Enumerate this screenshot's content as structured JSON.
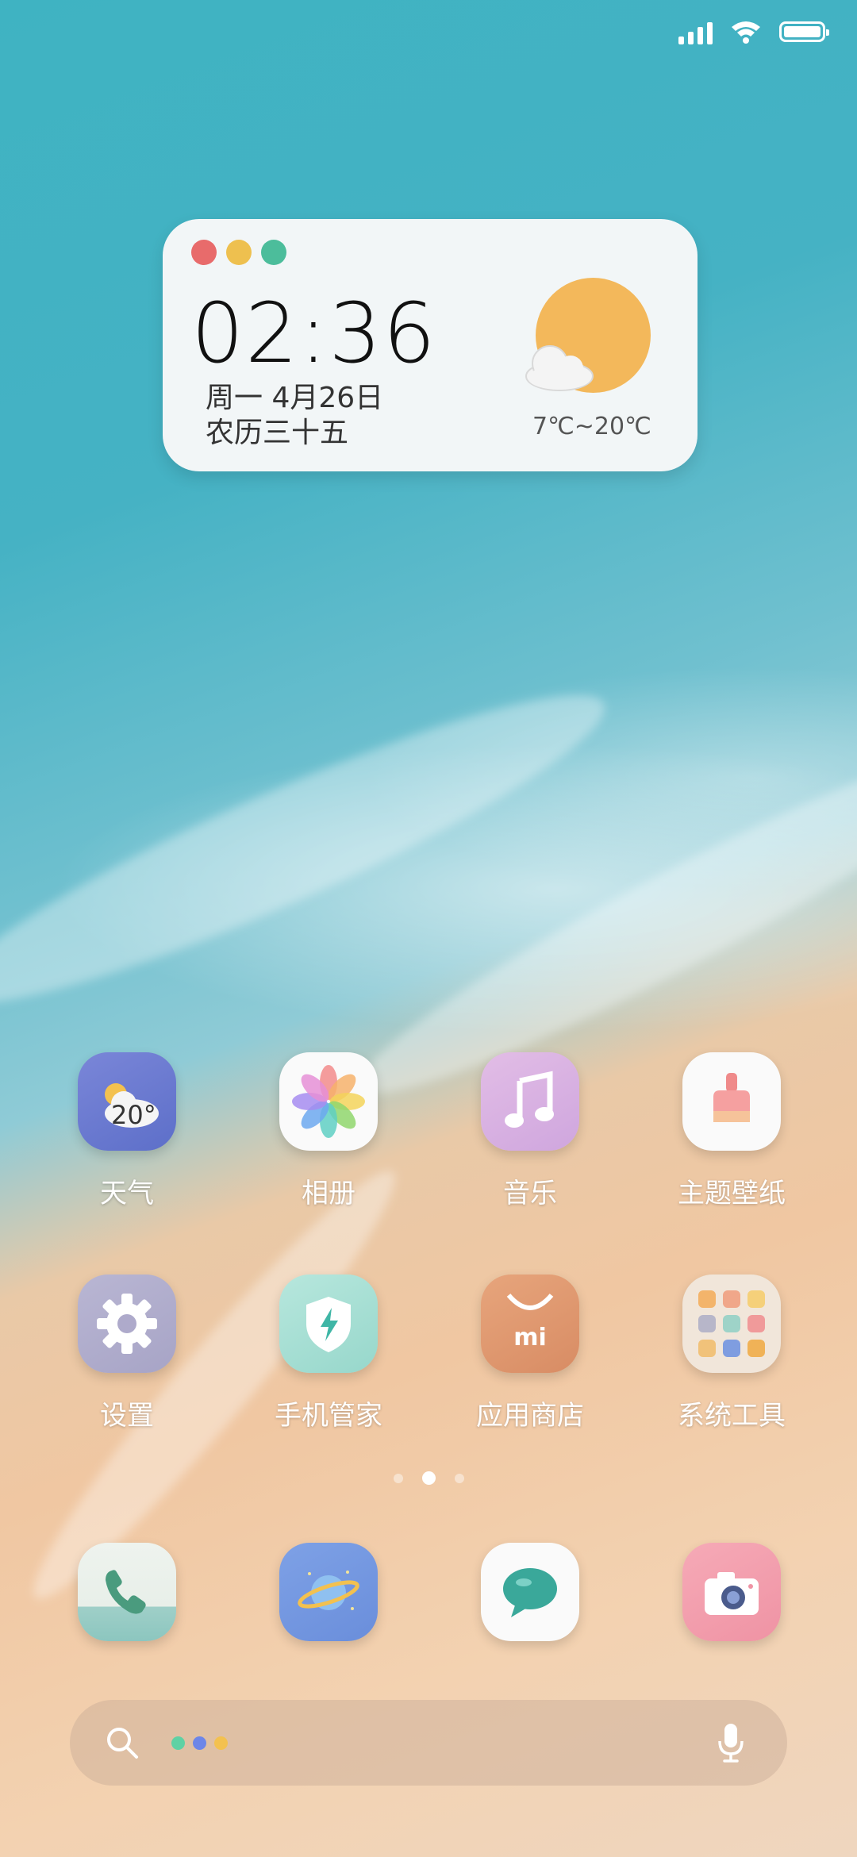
{
  "widget": {
    "time": "02:36",
    "date": "周一 4月26日",
    "lunar": "农历三十五",
    "temperature": "7℃~20℃",
    "dot_colors": [
      "#e86b6b",
      "#eec04f",
      "#4cbd9b"
    ]
  },
  "apps": [
    {
      "label": "天气",
      "icon": "weather-icon",
      "badge": "20°"
    },
    {
      "label": "相册",
      "icon": "gallery-icon"
    },
    {
      "label": "音乐",
      "icon": "music-icon"
    },
    {
      "label": "主题壁纸",
      "icon": "themes-icon"
    },
    {
      "label": "设置",
      "icon": "settings-icon"
    },
    {
      "label": "手机管家",
      "icon": "security-icon"
    },
    {
      "label": "应用商店",
      "icon": "app-store-icon",
      "badge": "mi"
    },
    {
      "label": "系统工具",
      "icon": "tools-folder-icon"
    }
  ],
  "dock": [
    {
      "icon": "phone-icon"
    },
    {
      "icon": "browser-icon"
    },
    {
      "icon": "messages-icon"
    },
    {
      "icon": "camera-icon"
    }
  ],
  "pager": {
    "pages": 3,
    "active": 1
  },
  "search": {
    "assist_colors": [
      "#5fd1a4",
      "#6d86e8",
      "#f3c14f"
    ]
  }
}
